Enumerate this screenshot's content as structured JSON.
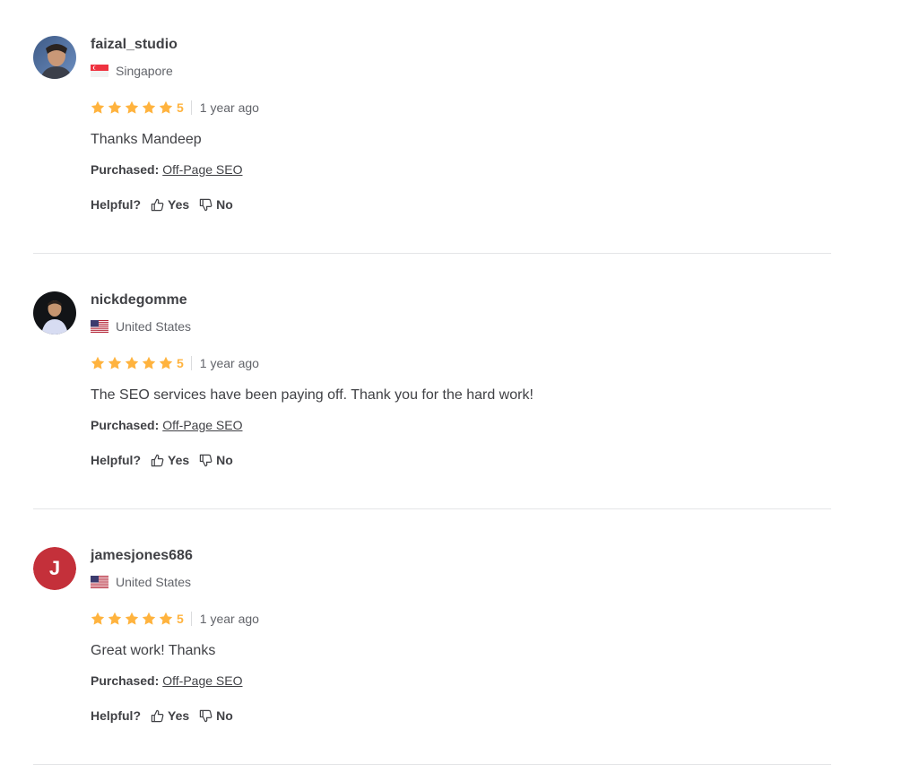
{
  "reviews": [
    {
      "username": "faizal_studio",
      "country": "Singapore",
      "flag_icon": "singapore-flag-icon",
      "rating": 5,
      "rating_label": "5",
      "time_ago": "1 year ago",
      "text": "Thanks Mandeep",
      "purchased_label": "Purchased:",
      "purchased_item": "Off-Page SEO",
      "helpful_label": "Helpful?",
      "yes_label": "Yes",
      "no_label": "No"
    },
    {
      "username": "nickdegomme",
      "country": "United States",
      "flag_icon": "us-flag-icon",
      "rating": 5,
      "rating_label": "5",
      "time_ago": "1 year ago",
      "text": "The SEO services have been paying off. Thank you for the hard work!",
      "purchased_label": "Purchased:",
      "purchased_item": "Off-Page SEO",
      "helpful_label": "Helpful?",
      "yes_label": "Yes",
      "no_label": "No"
    },
    {
      "username": "jamesjones686",
      "avatar_initial": "J",
      "country": "United States",
      "flag_icon": "us-flag-icon",
      "rating": 5,
      "rating_label": "5",
      "time_ago": "1 year ago",
      "text": "Great work! Thanks",
      "purchased_label": "Purchased:",
      "purchased_item": "Off-Page SEO",
      "helpful_label": "Helpful?",
      "yes_label": "Yes",
      "no_label": "No"
    }
  ],
  "colors": {
    "star": "#ffb33e",
    "initial_avatar_bg": "#c4303a",
    "divider": "#e4e5e7"
  }
}
